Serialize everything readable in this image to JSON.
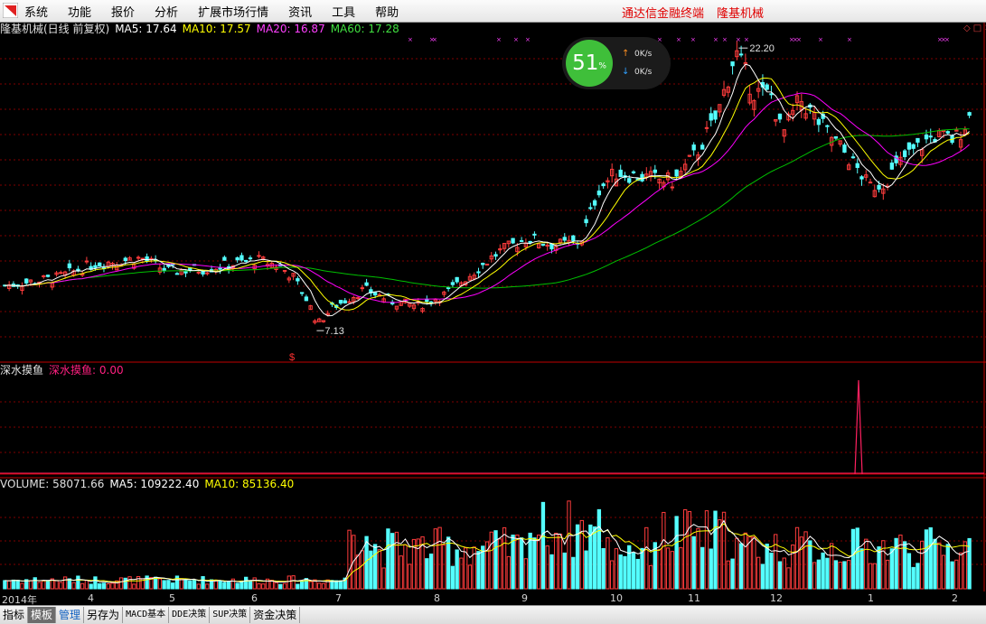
{
  "menubar": {
    "items": [
      "系统",
      "功能",
      "报价",
      "分析",
      "扩展市场行情",
      "资讯",
      "工具",
      "帮助"
    ],
    "app_name": "通达信金融终端",
    "stock_name": "隆基机械"
  },
  "price_header": {
    "title": "隆基机械(日线 前复权)",
    "ma5": "MA5: 17.64",
    "ma10": "MA10: 17.57",
    "ma20": "MA20: 16.87",
    "ma60": "MA60: 17.28"
  },
  "indicator_header": {
    "name": "深水摸鱼",
    "value": "深水摸鱼: 0.00"
  },
  "volume_header": {
    "volume": "VOLUME: 58071.66",
    "ma5": "MA5: 109222.40",
    "ma10": "MA10: 85136.40"
  },
  "speed_widget": {
    "percent": "51",
    "percent_sign": "%",
    "up_rate": "0K/s",
    "down_rate": "0K/s"
  },
  "annotations": {
    "high_label": "22.20",
    "low_label": "7.13",
    "signal_marker": "$"
  },
  "colors": {
    "up": "#ff3c3c",
    "down": "#54ffff",
    "ma5": "#ffffff",
    "ma10": "#ffff00",
    "ma20": "#ff00ff",
    "ma60": "#00c000",
    "grid": "#800000",
    "indicator": "#ff2060"
  },
  "chart_data": {
    "type": "candlestick",
    "x_axis_labels": [
      "2014年",
      "4",
      "5",
      "6",
      "7",
      "8",
      "9",
      "10",
      "11",
      "12",
      "1",
      "2"
    ],
    "price_range_estimate": [
      6.0,
      23.0
    ],
    "annotated_high": 22.2,
    "annotated_low": 7.13,
    "ma_lines": [
      "MA5",
      "MA10",
      "MA20",
      "MA60"
    ],
    "indicator_signal_month": "1",
    "last_values": {
      "MA5": 17.64,
      "MA10": 17.57,
      "MA20": 16.87,
      "MA60": 17.28,
      "VOLUME": 58071.66,
      "VOL_MA5": 109222.4,
      "VOL_MA10": 85136.4,
      "深水摸鱼": 0.0
    }
  },
  "tabs": [
    "指标",
    "模板",
    "管理",
    "另存为",
    "MACD基本",
    "DDE决策",
    "SUP决策",
    "资金决策"
  ]
}
